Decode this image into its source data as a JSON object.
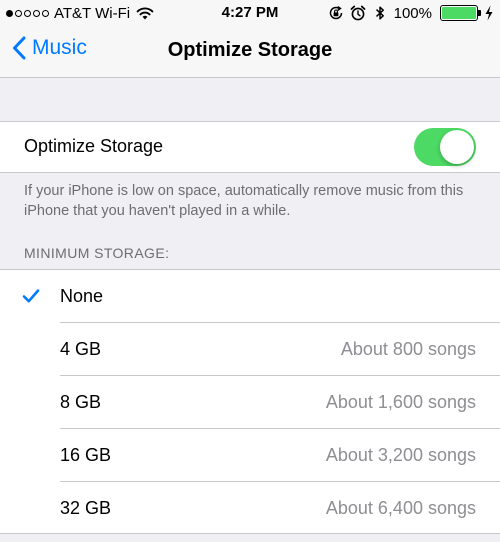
{
  "status_bar": {
    "carrier": "AT&T Wi-Fi",
    "signal_bars_filled": 1,
    "signal_bars_total": 5,
    "time": "4:27 PM",
    "battery_percent": "100%",
    "icons": [
      "wifi-icon",
      "orientation-lock-icon",
      "alarm-icon",
      "bluetooth-icon",
      "battery-icon",
      "charging-bolt-icon"
    ]
  },
  "nav": {
    "back_label": "Music",
    "title": "Optimize Storage"
  },
  "toggle": {
    "label": "Optimize Storage",
    "on": true
  },
  "footer_note": "If your iPhone is low on space, automatically remove music from this iPhone that you haven't played in a while.",
  "section_header": "MINIMUM STORAGE:",
  "options": [
    {
      "label": "None",
      "detail": "",
      "selected": true
    },
    {
      "label": "4 GB",
      "detail": "About 800 songs",
      "selected": false
    },
    {
      "label": "8 GB",
      "detail": "About 1,600 songs",
      "selected": false
    },
    {
      "label": "16 GB",
      "detail": "About 3,200 songs",
      "selected": false
    },
    {
      "label": "32 GB",
      "detail": "About 6,400 songs",
      "selected": false
    }
  ],
  "colors": {
    "accent": "#007aff",
    "switch_on": "#4cd964",
    "background": "#efeff4",
    "secondary_text": "#8e8e93"
  }
}
